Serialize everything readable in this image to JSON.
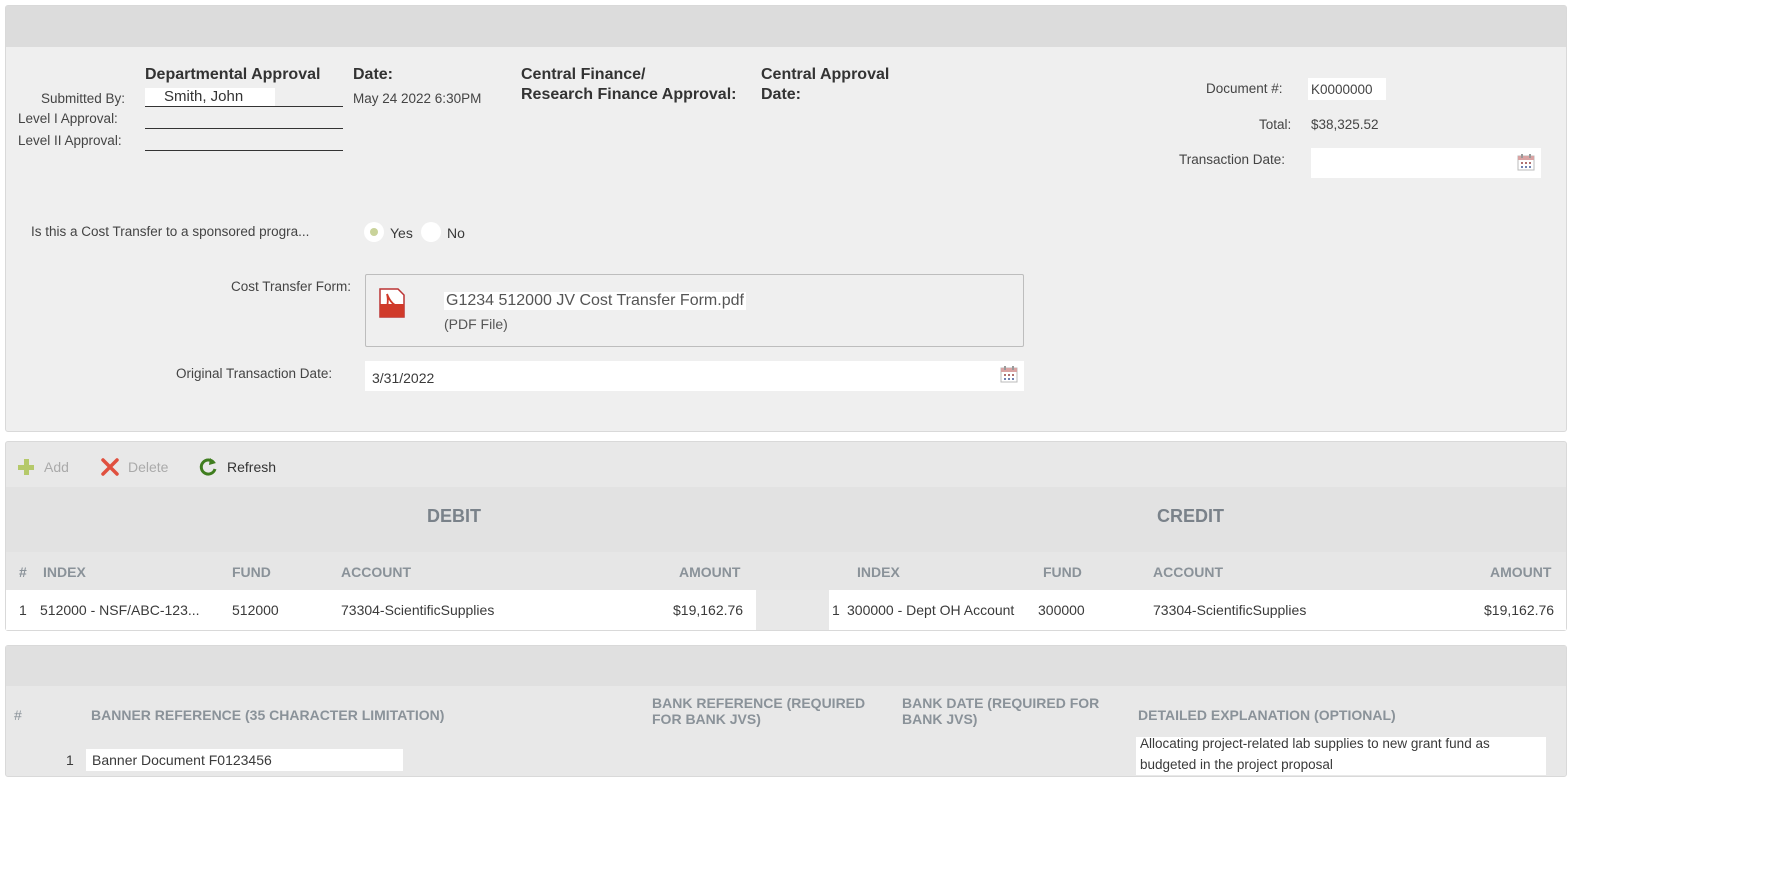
{
  "header": {
    "dept_approval": "Departmental Approval",
    "date1": "Date:",
    "central_finance_line1": "Central Finance/",
    "central_finance_line2": "Research Finance Approval:",
    "central_approval": "Central Approval",
    "date2": "Date:",
    "submitted_by_label": "Submitted By:",
    "submitted_by_value": "Smith, John",
    "submitted_date": "May 24 2022  6:30PM",
    "level1_label": "Level I Approval:",
    "level2_label": "Level II Approval:",
    "document_label": "Document #:",
    "document_value": "K0000000",
    "total_label": "Total:",
    "total_value": "$38,325.52",
    "transaction_date_label": "Transaction Date:",
    "transaction_date_value": ""
  },
  "cost_transfer": {
    "question": "Is this a Cost Transfer to a sponsored progra...",
    "yes_label": "Yes",
    "no_label": "No",
    "selected": "Yes",
    "form_label": "Cost Transfer Form:",
    "file_name": "G1234 512000 JV Cost Transfer Form.pdf",
    "file_type": "(PDF File)",
    "orig_date_label": "Original Transaction Date:",
    "orig_date_value": "3/31/2022"
  },
  "toolbar": {
    "add_label": "Add",
    "delete_label": "Delete",
    "refresh_label": "Refresh"
  },
  "ledger": {
    "debit_title": "DEBIT",
    "credit_title": "CREDIT",
    "columns": {
      "num": "#",
      "index": "INDEX",
      "fund": "FUND",
      "account": "ACCOUNT",
      "amount": "AMOUNT"
    },
    "rows": [
      {
        "num": "1",
        "debit_index": "512000 - NSF/ABC-123...",
        "debit_fund": "512000",
        "debit_account": "73304-ScientificSupplies",
        "debit_amount": "$19,162.76",
        "credit_num": "1",
        "credit_index": "300000 - Dept OH Account",
        "credit_fund": "300000",
        "credit_account": "73304-ScientificSupplies",
        "credit_amount": "$19,162.76"
      }
    ]
  },
  "banner": {
    "columns": {
      "num": "#",
      "banner_ref": "BANNER REFERENCE (35 CHARACTER LIMITATION)",
      "bank_ref_1": "BANK REFERENCE (REQUIRED",
      "bank_ref_2": "FOR BANK JVS)",
      "bank_date_1": "BANK DATE (REQUIRED FOR",
      "bank_date_2": "BANK JVS)",
      "explanation": "DETAILED EXPLANATION (OPTIONAL)"
    },
    "rows": [
      {
        "num": "1",
        "banner_ref": "Banner Document F0123456",
        "bank_ref": "",
        "bank_date": "",
        "explanation_1": "Allocating project-related lab supplies to new grant fund as",
        "explanation_2": "budgeted in the project proposal"
      }
    ]
  },
  "colors": {
    "panel_bg": "#efefef",
    "header_bar": "#dcdcdc",
    "column_header_text": "#8a9299",
    "radio_selected": "#c9d39a",
    "add_icon": "#b5c96a",
    "delete_icon": "#e0503f",
    "refresh_icon": "#3f7d1e",
    "pdf_red": "#d03a2a"
  }
}
